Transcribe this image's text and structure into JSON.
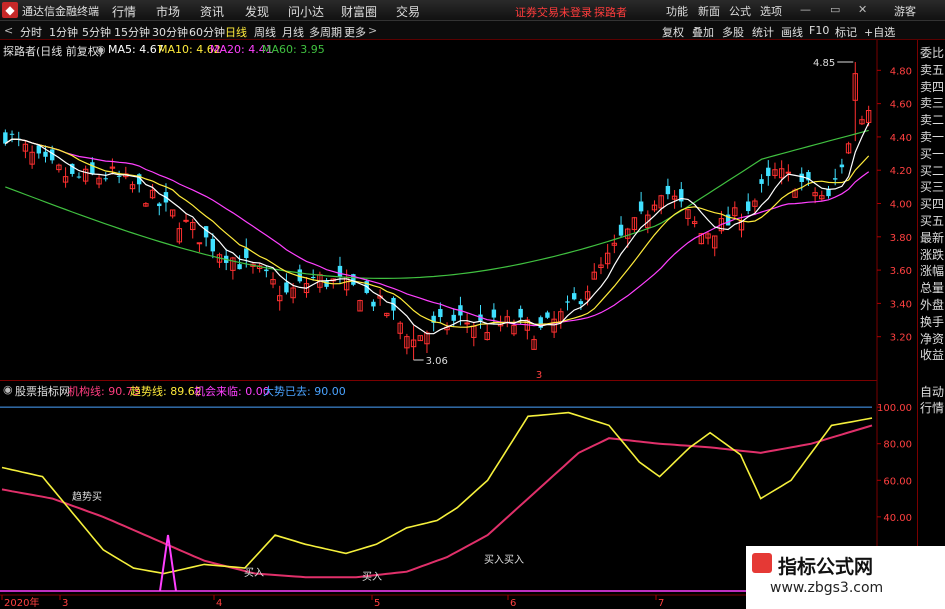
{
  "app": {
    "title": "通达信金融终端",
    "menus": [
      "行情",
      "市场",
      "资讯",
      "发现",
      "问小达",
      "财富圈",
      "交易"
    ],
    "warning": "证券交易未登录",
    "stock_name_top": "探路者",
    "right_menus": [
      "功能",
      "新面",
      "公式",
      "选项"
    ],
    "guest": "游客"
  },
  "toolbar": {
    "periods": [
      "分时",
      "1分钟",
      "5分钟",
      "15分钟",
      "30分钟",
      "60分钟",
      "日线",
      "周线",
      "月线",
      "多周期",
      "更多"
    ],
    "active": "日线",
    "right_tools": [
      "复权",
      "叠加",
      "多股",
      "统计",
      "画线",
      "F10",
      "标记",
      "+自选"
    ]
  },
  "main_chart": {
    "stock_label": "探路者(日线 前复权)",
    "ma5_label": "MA5: 4.67",
    "ma10_label": "MA10: 4.62",
    "ma20_label": "MA20: 4.41",
    "ma60_label": "MA60: 3.95",
    "high_label": "4.85",
    "low_label": "3.06",
    "marker": "3",
    "colors": {
      "ma5": "#ffffff",
      "ma10": "#ffeb3b",
      "ma20": "#ff40ff",
      "ma60": "#40c040",
      "up": "#ff3030",
      "down": "#40e0ff"
    },
    "price_ticks": [
      "4.80",
      "4.60",
      "4.40",
      "4.20",
      "4.00",
      "3.80",
      "3.60",
      "3.40",
      "3.20"
    ]
  },
  "side_panel": [
    "委比",
    "卖五",
    "卖四",
    "卖三",
    "卖二",
    "卖一",
    "买一",
    "买二",
    "买三",
    "买四",
    "买五",
    "最新",
    "涨跌",
    "涨幅",
    "总量",
    "外盘",
    "换手",
    "净资",
    "收益"
  ],
  "side_panel_bottom": [
    "自动",
    "行情"
  ],
  "indicator": {
    "name": "股票指标网",
    "line1": "机构线: 90.73",
    "line2": "趋势线: 89.62",
    "line3": "机会来临: 0.00",
    "line4": "大势已去: 90.00",
    "ticks": [
      "100.00",
      "80.00",
      "60.00",
      "40.00"
    ],
    "annotations": [
      "趋势买",
      "买入",
      "买入",
      "买入买入"
    ]
  },
  "xaxis": {
    "labels": [
      "2020年",
      "3",
      "4",
      "5",
      "6",
      "7"
    ]
  },
  "watermark": {
    "title": "指标公式网",
    "url": "www.zbgs3.com"
  }
}
